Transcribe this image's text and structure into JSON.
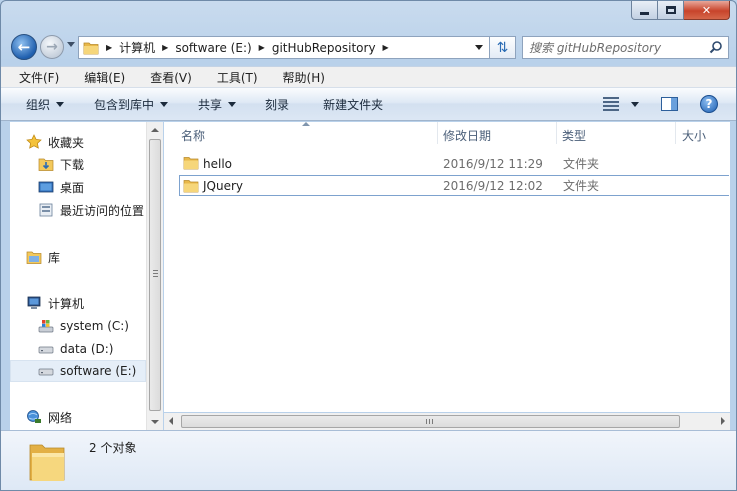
{
  "window": {
    "caption_buttons": {
      "minimize": "minimize",
      "maximize": "maximize",
      "close": "✕"
    }
  },
  "address": {
    "crumbs": [
      "计算机",
      "software (E:)",
      "gitHubRepository"
    ]
  },
  "search": {
    "placeholder": "搜索 gitHubRepository"
  },
  "menubar": [
    "文件(F)",
    "编辑(E)",
    "查看(V)",
    "工具(T)",
    "帮助(H)"
  ],
  "commands": [
    {
      "label": "组织",
      "dropdown": true
    },
    {
      "label": "包含到库中",
      "dropdown": true
    },
    {
      "label": "共享",
      "dropdown": true
    },
    {
      "label": "刻录",
      "dropdown": false
    },
    {
      "label": "新建文件夹",
      "dropdown": false
    }
  ],
  "help_glyph": "?",
  "navpane": {
    "favorites": {
      "label": "收藏夹",
      "items": [
        "下载",
        "桌面",
        "最近访问的位置"
      ]
    },
    "libraries": {
      "label": "库"
    },
    "computer": {
      "label": "计算机",
      "items": [
        "system (C:)",
        "data (D:)",
        "software (E:)"
      ],
      "selected": "software (E:)"
    },
    "network": {
      "label": "网络"
    }
  },
  "columns": [
    "名称",
    "修改日期",
    "类型",
    "大小"
  ],
  "files": [
    {
      "name": "hello",
      "date": "2016/9/12 11:29",
      "type": "文件夹"
    },
    {
      "name": "JQuery",
      "date": "2016/9/12 12:02",
      "type": "文件夹"
    }
  ],
  "details": {
    "count": "2 个对象"
  },
  "colors": {
    "folder": "#f3c95c",
    "accent": "#2b6cb4"
  }
}
